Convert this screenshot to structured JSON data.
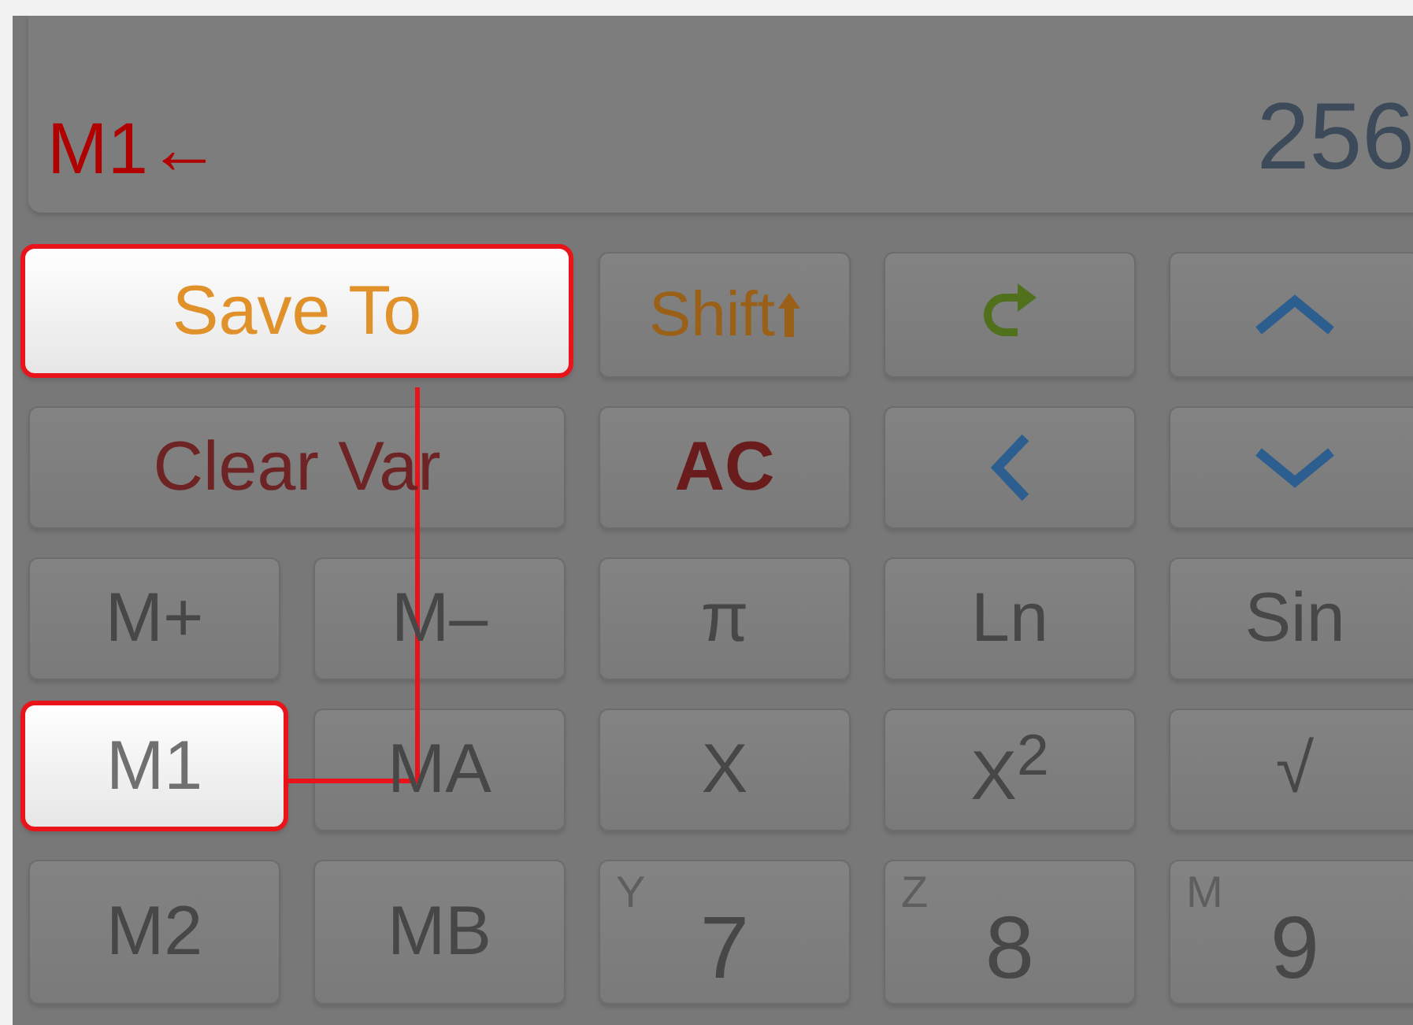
{
  "display": {
    "memory_label": "M1←",
    "value": "256"
  },
  "keys": [
    {
      "kind": "text",
      "label": "Save To",
      "wide": true,
      "highlighted": true,
      "color": "#e0912a"
    },
    {
      "kind": "shift",
      "label": "Shift",
      "wide": false,
      "highlighted": false,
      "color": "#9a6018"
    },
    {
      "kind": "redo",
      "wide": false,
      "highlighted": false,
      "color": "#50701c"
    },
    {
      "kind": "up",
      "wide": false,
      "highlighted": false,
      "color": "#2c5f8f"
    },
    {
      "kind": "text",
      "label": "Clear Var",
      "wide": true,
      "highlighted": false,
      "color": "#6e2424"
    },
    {
      "kind": "bold",
      "label": "AC",
      "wide": false,
      "highlighted": false,
      "color": "#6a1c1c"
    },
    {
      "kind": "left",
      "wide": false,
      "highlighted": false,
      "color": "#2c5f8f"
    },
    {
      "kind": "down",
      "wide": false,
      "highlighted": false,
      "color": "#2c5f8f"
    },
    {
      "kind": "text",
      "label": "M+",
      "wide": false,
      "highlighted": false,
      "color": "#474747"
    },
    {
      "kind": "text",
      "label": "M–",
      "wide": false,
      "highlighted": false,
      "color": "#474747"
    },
    {
      "kind": "text",
      "label": "π",
      "wide": false,
      "highlighted": false,
      "color": "#474747"
    },
    {
      "kind": "text",
      "label": "Ln",
      "wide": false,
      "highlighted": false,
      "color": "#474747"
    },
    {
      "kind": "text",
      "label": "Sin",
      "wide": false,
      "highlighted": false,
      "color": "#474747"
    },
    {
      "kind": "text",
      "label": "M1",
      "wide": false,
      "highlighted": true,
      "color": "#707070"
    },
    {
      "kind": "text",
      "label": "MA",
      "wide": false,
      "highlighted": false,
      "color": "#474747"
    },
    {
      "kind": "text",
      "label": "X",
      "wide": false,
      "highlighted": false,
      "color": "#474747"
    },
    {
      "kind": "text",
      "label": "X$^{2}$",
      "wide": false,
      "highlighted": false,
      "color": "#474747"
    },
    {
      "kind": "text",
      "label": "√",
      "wide": false,
      "highlighted": false,
      "color": "#474747"
    },
    {
      "kind": "text",
      "label": "M2",
      "wide": false,
      "highlighted": false,
      "color": "#474747"
    },
    {
      "kind": "text",
      "label": "MB",
      "wide": false,
      "highlighted": false,
      "color": "#474747"
    },
    {
      "kind": "digit",
      "label": "7",
      "corner": "Y",
      "wide": false,
      "highlighted": false,
      "color": "#474747"
    },
    {
      "kind": "digit",
      "label": "8",
      "corner": "Z",
      "wide": false,
      "highlighted": false,
      "color": "#474747"
    },
    {
      "kind": "digit",
      "label": "9",
      "corner": "M",
      "wide": false,
      "highlighted": false,
      "color": "#474747"
    }
  ]
}
